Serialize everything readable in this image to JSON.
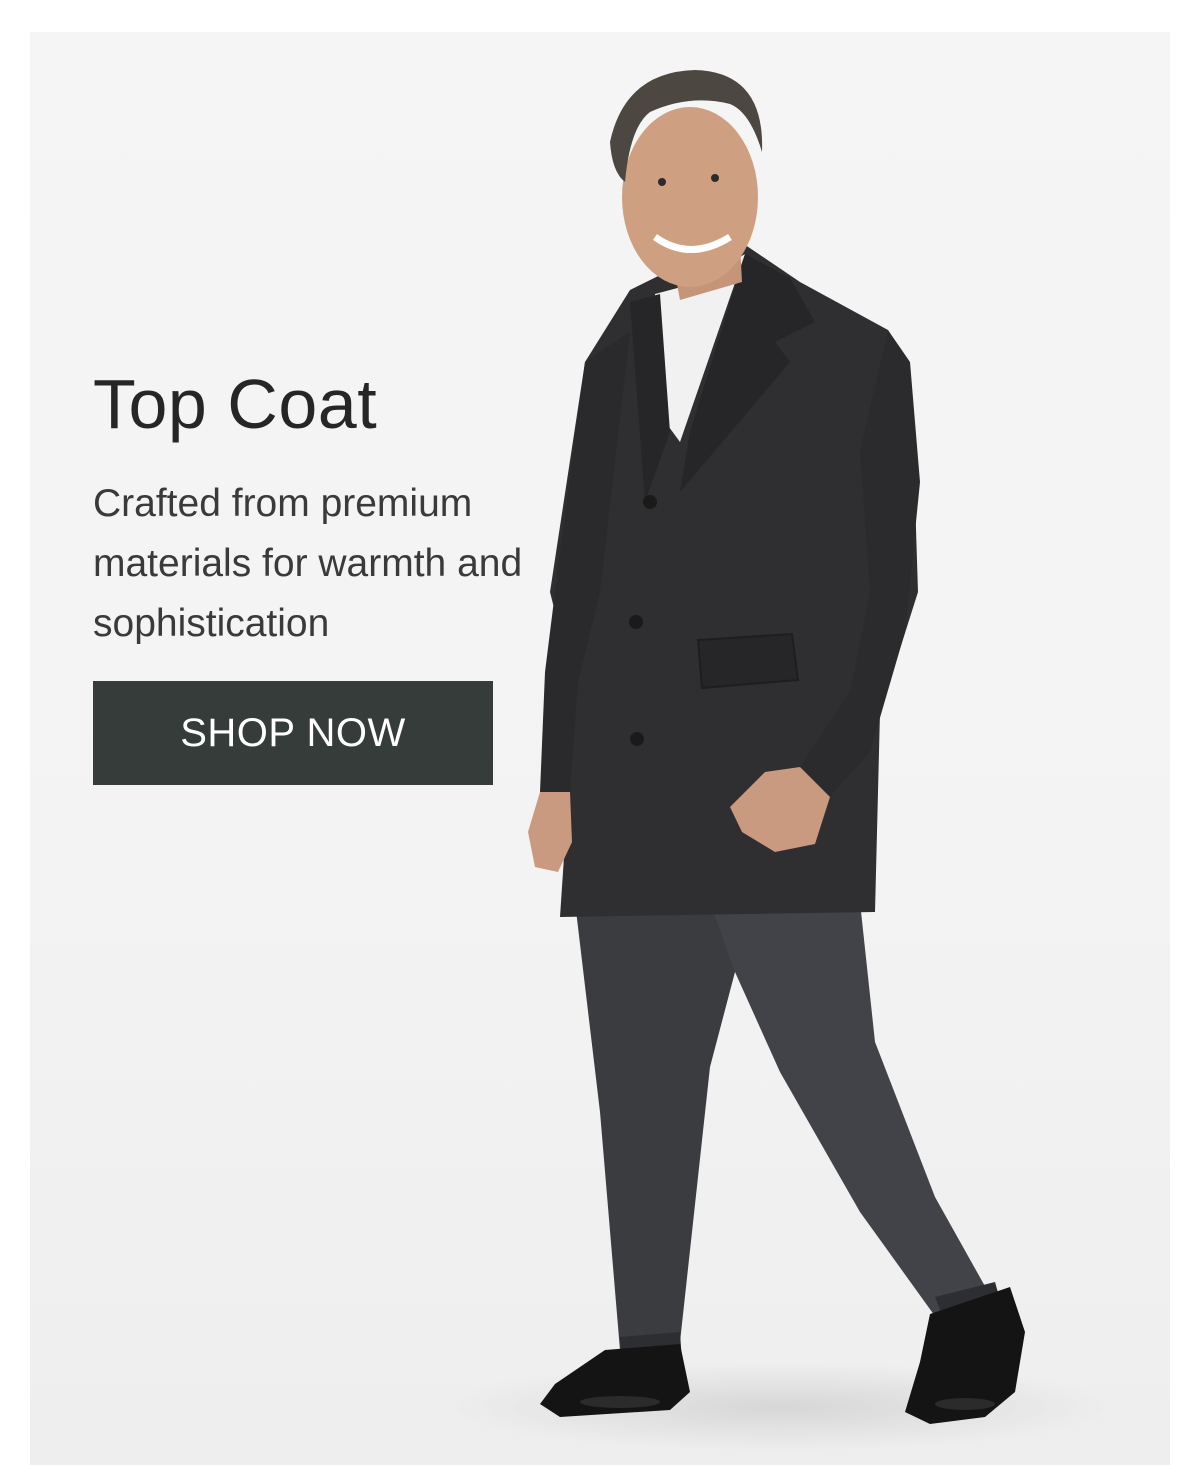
{
  "banner": {
    "headline": "Top Coat",
    "subcopy": "Crafted from premium materials for warmth and sophistication",
    "cta_label": "SHOP NOW",
    "colors": {
      "cta_background": "#363c3a",
      "cta_text": "#ffffff",
      "background": "#f4f4f4",
      "headline": "#262626"
    },
    "image": {
      "subject": "man-in-charcoal-top-coat"
    }
  }
}
